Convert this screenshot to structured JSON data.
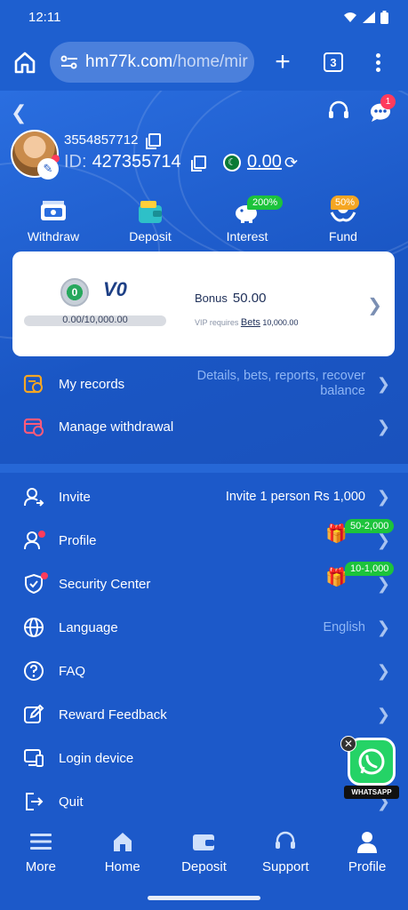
{
  "status": {
    "time": "12:11"
  },
  "browser": {
    "url_domain": "hm77k.com",
    "url_path": "/home/mir",
    "tab_count": "3"
  },
  "header": {
    "notification_count": "1",
    "phone": "3554857712",
    "id_label": "ID:",
    "user_id": "427355714",
    "balance": "0.00"
  },
  "quick_actions": [
    {
      "label": "Withdraw"
    },
    {
      "label": "Deposit"
    },
    {
      "label": "Interest",
      "tag": "200%"
    },
    {
      "label": "Fund",
      "tag": "50%"
    }
  ],
  "vip": {
    "badge": "0",
    "level": "V0",
    "progress_text": "0.00/10,000.00",
    "progress_fraction": 0,
    "bonus_label": "Bonus",
    "bonus_value": "50.00",
    "requires_label": "VIP requires",
    "requires_link": "Bets",
    "requires_value": "10,000.00"
  },
  "records": {
    "my_records_label": "My records",
    "my_records_hint": "Details, bets, reports, recover balance",
    "manage_withdrawal_label": "Manage withdrawal"
  },
  "menu": {
    "invite_label": "Invite",
    "invite_hint": "Invite 1 person Rs 1,000",
    "profile_label": "Profile",
    "profile_gift": "50-2,000",
    "security_label": "Security Center",
    "security_gift": "10-1,000",
    "language_label": "Language",
    "language_value": "English",
    "faq_label": "FAQ",
    "feedback_label": "Reward Feedback",
    "login_device_label": "Login device",
    "quit_label": "Quit"
  },
  "whatsapp": {
    "label": "WHATSAPP"
  },
  "bottom_nav": [
    {
      "label": "More"
    },
    {
      "label": "Home"
    },
    {
      "label": "Deposit"
    },
    {
      "label": "Support"
    },
    {
      "label": "Profile"
    }
  ],
  "colors": {
    "primary": "#1d5fd0",
    "accent_green": "#1cc33b",
    "badge_red": "#ff3b5c",
    "hint_blue": "#8fb6f5"
  }
}
